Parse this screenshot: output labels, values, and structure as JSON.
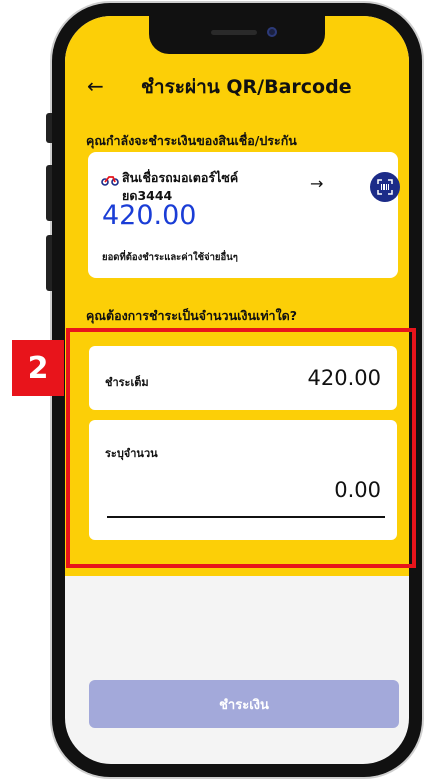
{
  "header": {
    "back_icon": "arrow-left-icon",
    "title": "ชำระผ่าน QR/Barcode"
  },
  "payment_info": {
    "prompt": "คุณกำลังจะชำระเงินของสินเชื่อ/ประกัน",
    "product_icon": "motorcycle-icon",
    "product_name": "สินเชื่อรถมอเตอร์ไซค์",
    "product_code": "ยด3444",
    "amount": "420.00",
    "note": "ยอดที่ต้องชำระและค่าใช้จ่ายอื่นๆ",
    "arrow_icon": "arrow-right-icon",
    "qr_icon": "qr-scan-icon"
  },
  "amount_section": {
    "prompt": "คุณต้องการชำระเป็นจำนวนเงินเท่าใด?",
    "step_badge": "2",
    "full_payment": {
      "label": "ชำระเต็ม",
      "value": "420.00"
    },
    "custom_payment": {
      "label": "ระบุจำนวน",
      "value": "0.00"
    }
  },
  "pay_button": {
    "label": "ชำระเงิน"
  },
  "colors": {
    "accent_yellow": "#fccf07",
    "brand_blue": "#1a3dd6",
    "highlight_red": "#e8141b",
    "button_disabled": "#a3a9da"
  }
}
